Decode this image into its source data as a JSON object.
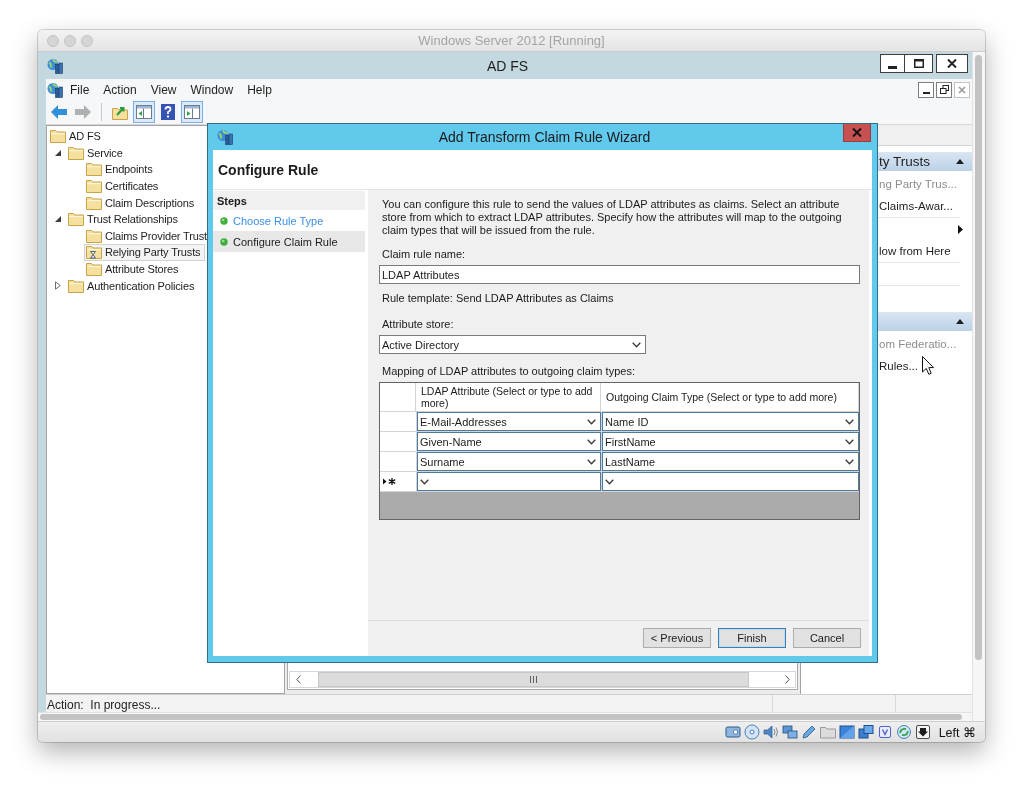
{
  "host_window": {
    "title": "Windows Server 2012 [Running]",
    "host_key": "Left ⌘"
  },
  "app_window": {
    "title": "AD FS"
  },
  "menu": [
    "File",
    "Action",
    "View",
    "Window",
    "Help"
  ],
  "toolbar": [
    {
      "kind": "back",
      "disabled": false,
      "pressed": false
    },
    {
      "kind": "forward",
      "disabled": true,
      "pressed": false
    },
    {
      "kind": "separator"
    },
    {
      "kind": "up",
      "disabled": false,
      "pressed": false
    },
    {
      "kind": "console-tree",
      "disabled": false,
      "pressed": true
    },
    {
      "kind": "help",
      "disabled": false,
      "pressed": false
    },
    {
      "kind": "action-pane",
      "disabled": false,
      "pressed": true
    }
  ],
  "tree": [
    {
      "label": "AD FS",
      "selected": false,
      "busy": false,
      "children": [
        {
          "label": "Service",
          "expanded": true,
          "selected": false,
          "busy": false,
          "children": [
            {
              "label": "Endpoints",
              "selected": false,
              "busy": false
            },
            {
              "label": "Certificates",
              "selected": false,
              "busy": false
            },
            {
              "label": "Claim Descriptions",
              "selected": false,
              "busy": false
            }
          ]
        },
        {
          "label": "Trust Relationships",
          "expanded": true,
          "selected": false,
          "busy": false,
          "children": [
            {
              "label": "Claims Provider Trust",
              "selected": false,
              "busy": false
            },
            {
              "label": "Relying Party Trusts",
              "selected": true,
              "busy": true
            },
            {
              "label": "Attribute Stores",
              "selected": false,
              "busy": false
            }
          ]
        },
        {
          "label": "Authentication Policies",
          "expanded": false,
          "selected": false,
          "busy": false
        }
      ]
    }
  ],
  "actions_pane": {
    "sections": [
      {
        "title": "ty Trusts",
        "expanded": true,
        "items": [
          {
            "kind": "action",
            "label": "ng Party Trus...",
            "disabled": true
          },
          {
            "kind": "action",
            "label": "Claims-Awar...",
            "disabled": false
          },
          {
            "kind": "separator"
          },
          {
            "kind": "submenu"
          },
          {
            "kind": "action",
            "label": "low from Here",
            "disabled": false
          },
          {
            "kind": "separator"
          },
          {
            "kind": "separator"
          }
        ]
      },
      {
        "expanded": true,
        "items": [
          {
            "kind": "action",
            "label": "om Federatio...",
            "disabled": true
          },
          {
            "kind": "action",
            "label": "Rules...",
            "disabled": false
          }
        ]
      }
    ]
  },
  "wizard": {
    "title": "Add Transform Claim Rule Wizard",
    "heading": "Configure Rule",
    "steps_title": "Steps",
    "steps": [
      {
        "label": "Choose Rule Type",
        "selected": false
      },
      {
        "label": "Configure Claim Rule",
        "selected": true
      }
    ],
    "description": "You can configure this rule to send the values of LDAP attributes as claims. Select an attribute store from which to extract LDAP attributes. Specify how the attributes will map to the outgoing claim types that will be issued from the rule.",
    "rule_name": {
      "label": "Claim rule name:",
      "value": "LDAP Attributes"
    },
    "template_text": "Rule template: Send LDAP Attributes as Claims",
    "attribute_store": {
      "label": "Attribute store:",
      "value": "Active Directory"
    },
    "mapping": {
      "label": "Mapping of LDAP attributes to outgoing claim types:",
      "columns": [
        "LDAP Attribute (Select or type to add more)",
        "Outgoing Claim Type (Select or type to add more)"
      ],
      "rows": [
        {
          "kind": "entry",
          "ldap_attribute": "E-Mail-Addresses",
          "claim_type": "Name ID"
        },
        {
          "kind": "entry",
          "ldap_attribute": "Given-Name",
          "claim_type": "FirstName"
        },
        {
          "kind": "entry",
          "ldap_attribute": "Surname",
          "claim_type": "LastName"
        },
        {
          "kind": "new"
        }
      ]
    },
    "buttons": [
      {
        "label": "< Previous",
        "default": false
      },
      {
        "label": "Finish",
        "default": true
      },
      {
        "label": "Cancel",
        "default": false
      }
    ]
  },
  "status_bar": {
    "text": "Action:  In progress..."
  }
}
